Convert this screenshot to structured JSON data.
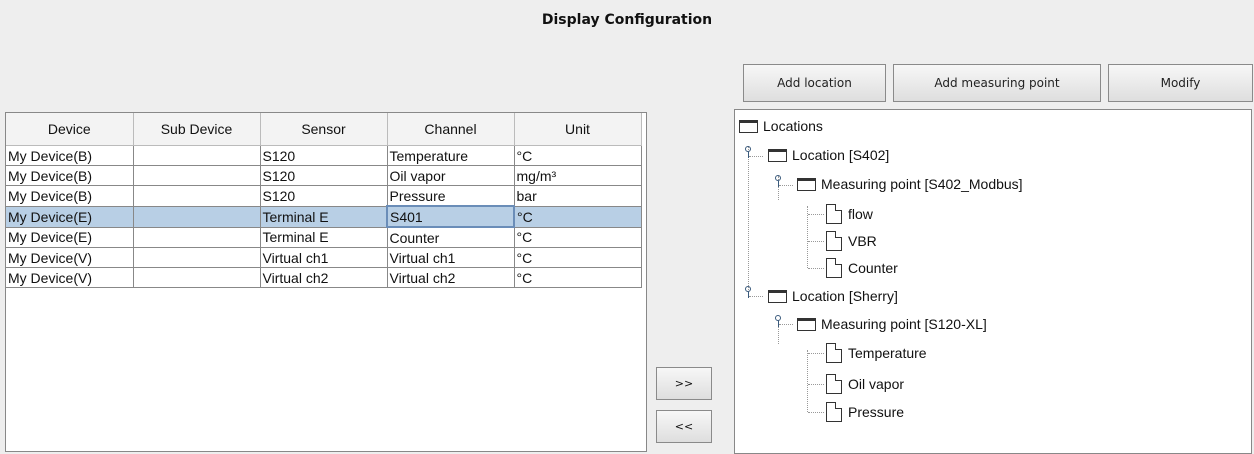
{
  "title": "Display Configuration",
  "toolbar": {
    "add_location": "Add location",
    "add_measuring_point": "Add measuring point",
    "modify": "Modify"
  },
  "move": {
    "right": ">>",
    "left": "<<"
  },
  "table": {
    "headers": [
      "Device",
      "Sub Device",
      "Sensor",
      "Channel",
      "Unit"
    ],
    "rows": [
      [
        "My Device(B)",
        "",
        "S120",
        "Temperature",
        "°C"
      ],
      [
        "My Device(B)",
        "",
        "S120",
        "Oil vapor",
        "mg/m³"
      ],
      [
        "My Device(B)",
        "",
        "S120",
        "Pressure",
        "bar"
      ],
      [
        "My Device(E)",
        "",
        "Terminal E",
        "S401",
        "°C"
      ],
      [
        "My Device(E)",
        "",
        "Terminal E",
        "Counter",
        "°C"
      ],
      [
        "My Device(V)",
        "",
        "Virtual ch1",
        "Virtual ch1",
        "°C"
      ],
      [
        "My Device(V)",
        "",
        "Virtual ch2",
        "Virtual ch2",
        "°C"
      ]
    ],
    "selected_row": 3
  },
  "tree": {
    "root": "Locations",
    "loc1": "Location [S402]",
    "mp1": "Measuring point [S402_Modbus]",
    "mp1_items": [
      "flow",
      "VBR",
      "Counter"
    ],
    "loc2": "Location [Sherry]",
    "mp2": "Measuring point [S120-XL]",
    "mp2_items": [
      "Temperature",
      "Oil vapor",
      "Pressure"
    ]
  }
}
